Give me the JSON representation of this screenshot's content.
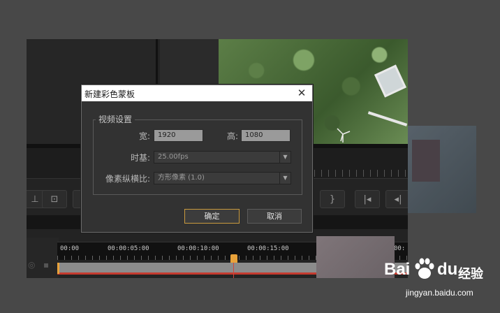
{
  "dialog": {
    "title": "新建彩色蒙板",
    "group_label": "视频设置",
    "width_label": "宽:",
    "width_value": "1920",
    "height_label": "高:",
    "height_value": "1080",
    "timebase_label": "时基:",
    "timebase_value": "25.00fps",
    "pixel_aspect_label": "像素纵横比:",
    "pixel_aspect_value": "方形像素 (1.0)",
    "ok_label": "确定",
    "cancel_label": "取消"
  },
  "timeline": {
    "labels": [
      "00:00",
      "00:00:05:00",
      "00:00:10:00",
      "00:00:15:00",
      "00:"
    ]
  },
  "watermark": {
    "brand_left": "Bai",
    "brand_right": "du",
    "product": "经验",
    "url": "jingyan.baidu.com"
  },
  "colors": {
    "accent_orange": "#e8a23a",
    "playhead_red": "#c43a2e",
    "primary_button_border": "#c99a3e"
  }
}
